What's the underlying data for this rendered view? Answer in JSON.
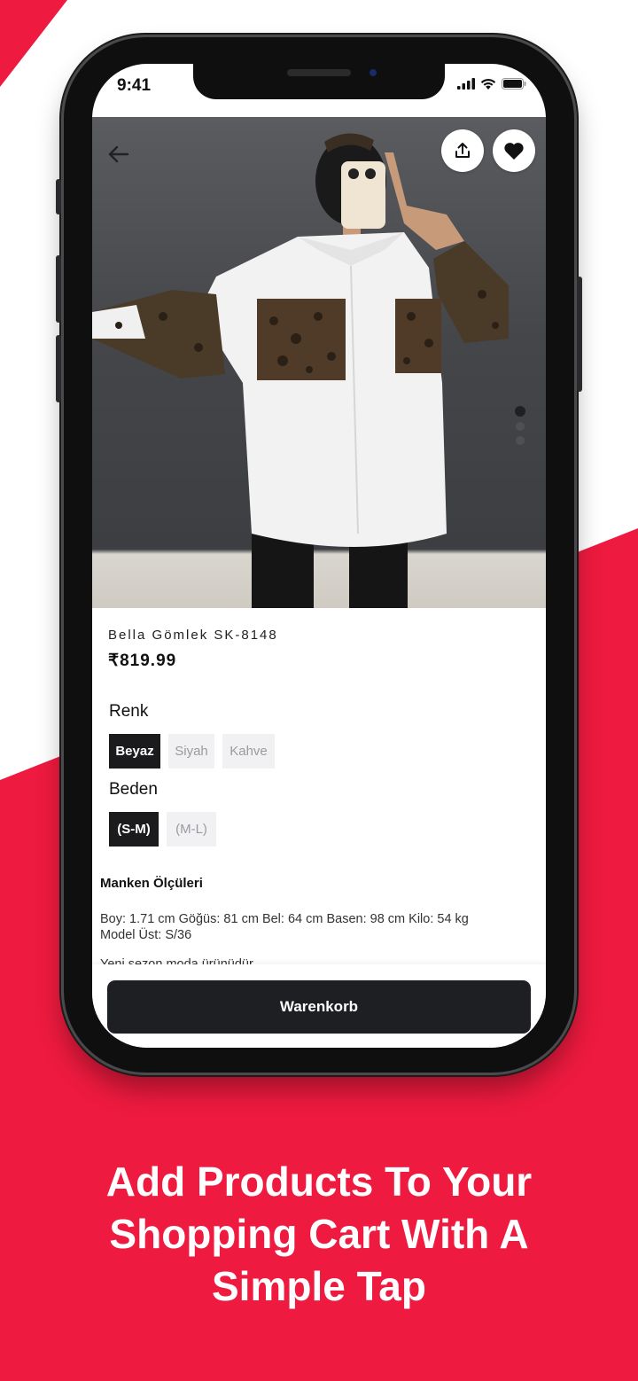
{
  "colors": {
    "accent": "#ee1a3f",
    "dark": "#1b1b1d",
    "chip_bg": "#f1f1f3"
  },
  "status": {
    "time": "9:41",
    "icons": [
      "signal-icon",
      "wifi-icon",
      "battery-icon"
    ]
  },
  "toolbar": {
    "back_icon": "arrow-left-icon",
    "share_icon": "share-icon",
    "favorite_icon": "heart-icon"
  },
  "product": {
    "name": "Bella Gömlek SK-8148",
    "price": "₹819.99",
    "image_pages": 3
  },
  "color_section": {
    "label": "Renk",
    "options": [
      "Beyaz",
      "Siyah",
      "Kahve"
    ],
    "selected": "Beyaz"
  },
  "size_section": {
    "label": "Beden",
    "options": [
      "(S-M)",
      "(M-L)"
    ],
    "selected": "(S-M)"
  },
  "model": {
    "title": "Manken Ölçüleri",
    "measurements": "Boy: 1.71 cm   Göğüs: 81 cm   Bel: 64 cm   Basen: 98 cm   Kilo: 54 kg",
    "size": "Model Üst: S/36",
    "description": "Yeni sezon moda ürünüdür."
  },
  "cart": {
    "button_label": "Warenkorb"
  },
  "promo": {
    "line1": "Add Products To Your",
    "line2": "Shopping Cart With A",
    "line3": "Simple Tap"
  }
}
